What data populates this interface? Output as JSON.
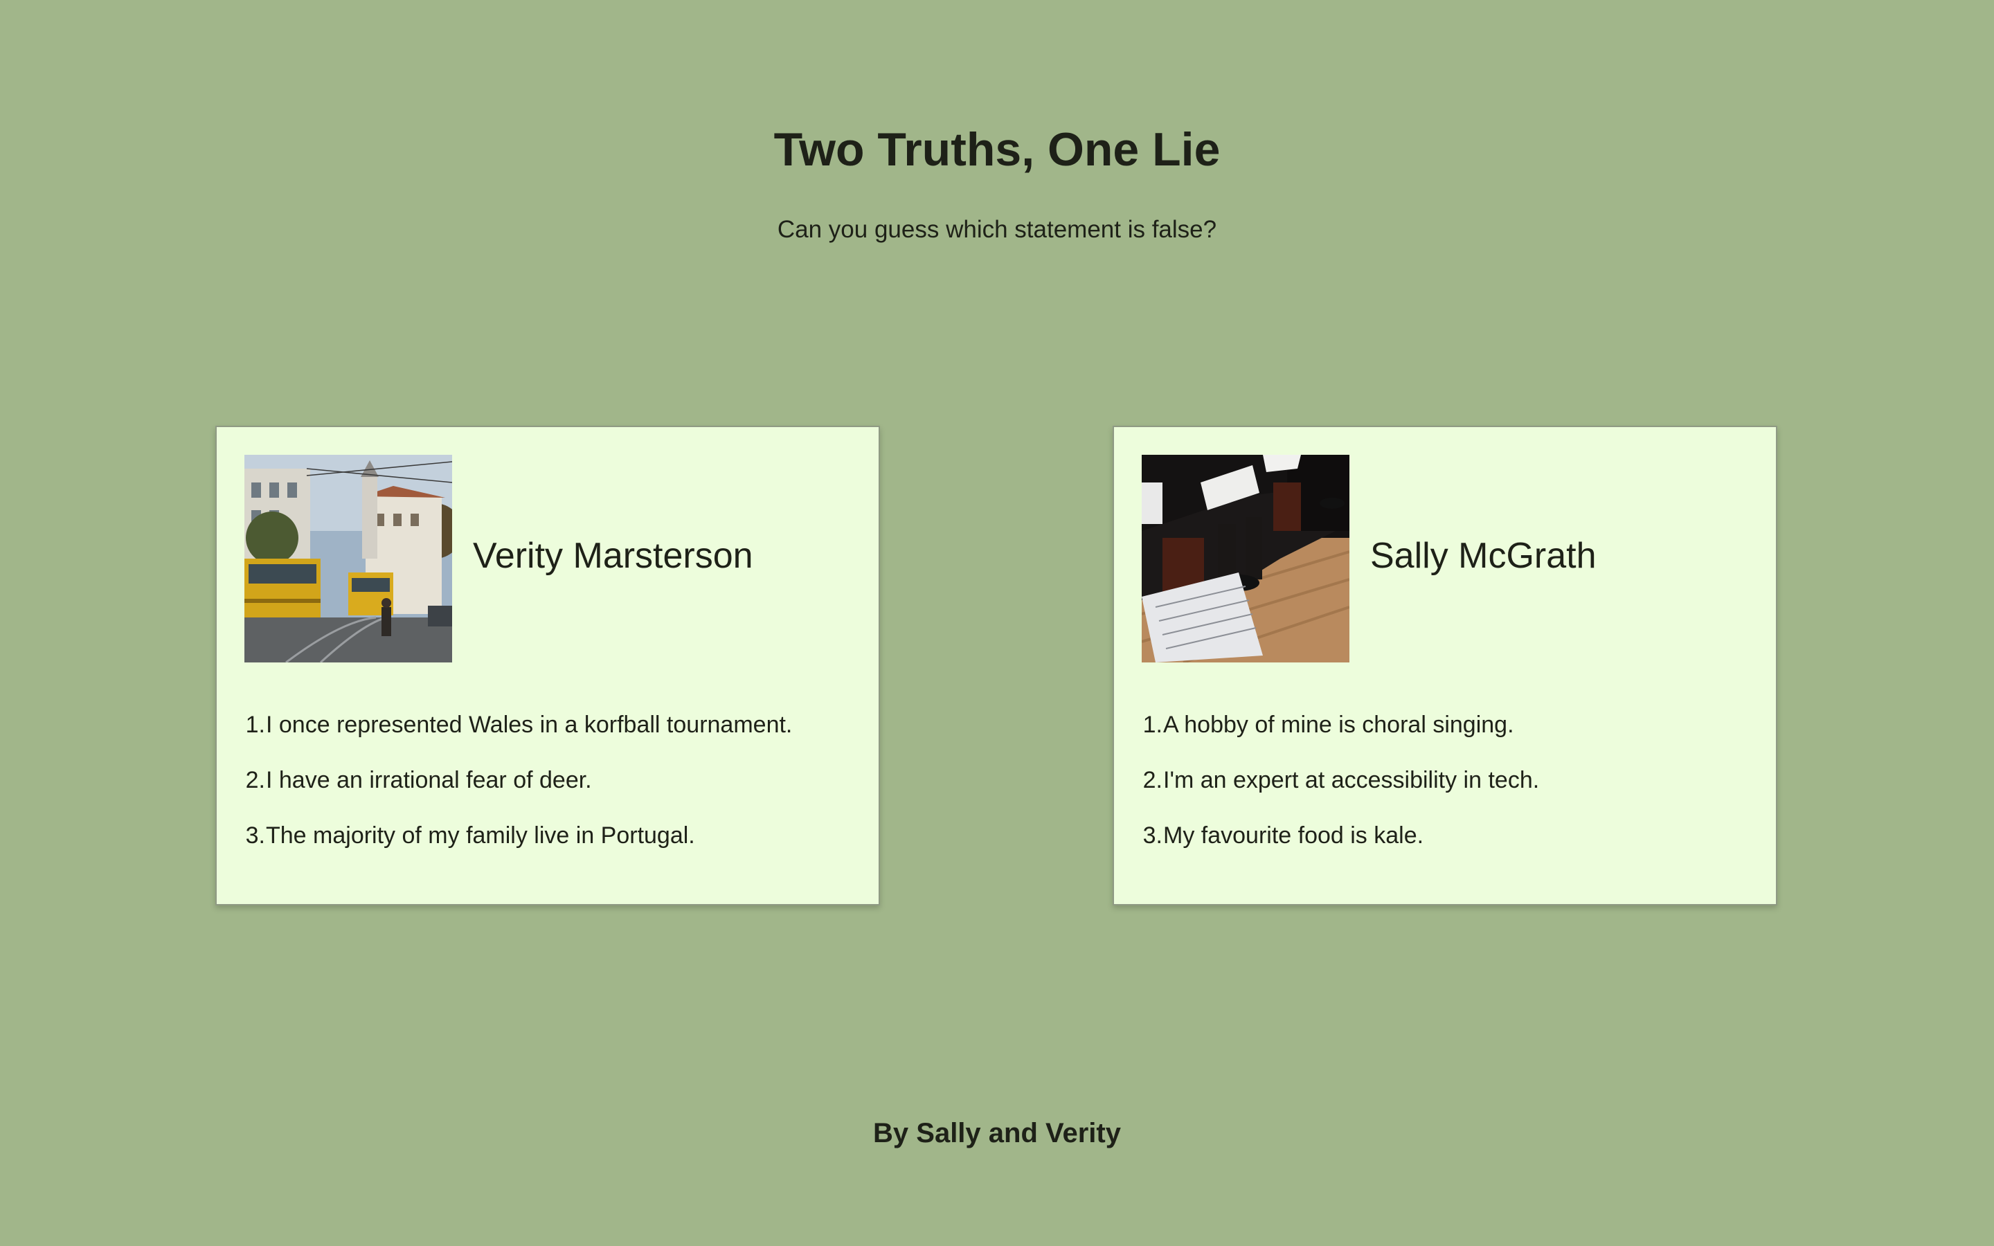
{
  "header": {
    "title": "Two Truths, One Lie",
    "subtitle": "Can you guess which statement is false?"
  },
  "cards": [
    {
      "name": "Verity Marsterson",
      "photo_icon": "city-tram-photo",
      "facts": [
        {
          "num": "1.",
          "text": "I once represented Wales in a korfball tournament."
        },
        {
          "num": "2.",
          "text": "I have an irrational fear of deer."
        },
        {
          "num": "3.",
          "text": "The majority of my family live in Portugal."
        }
      ]
    },
    {
      "name": "Sally McGrath",
      "photo_icon": "choir-singers-photo",
      "facts": [
        {
          "num": "1.",
          "text": "A hobby of mine is choral singing."
        },
        {
          "num": "2.",
          "text": "I'm an expert at accessibility in tech."
        },
        {
          "num": "3.",
          "text": "My favourite food is kale."
        }
      ]
    }
  ],
  "footer": {
    "text": "By Sally and Verity"
  },
  "colors": {
    "background": "#a1b68a",
    "card": "#edfddc",
    "text": "#1e2118"
  }
}
